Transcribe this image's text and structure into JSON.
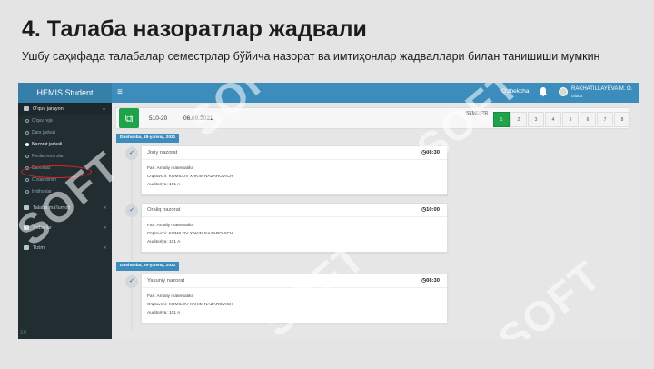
{
  "slide": {
    "title": "4. Талаба назоратлар жадвали",
    "subtitle": "Ушбу саҳифада талабалар семестрлар бўйича назорат ва имтиҳонлар жадваллари билан танишиши мумкин"
  },
  "topbar": {
    "brand": "HEMIS Student",
    "menu_glyph": "≡",
    "language": "O'zbekcha",
    "user_name": "RAKHATILLAYEVA M. O.",
    "user_role": "talaba"
  },
  "sidebar": {
    "section": "O'quv jarayoni",
    "section_chevron": "⌄",
    "sub_items": [
      "O'quv reja",
      "Dars jadvali",
      "Nazorat jadvali",
      "Fanlar resurslari",
      "Davomat",
      "O'zlashtirish",
      "Imtihonlar"
    ],
    "active_index": 2,
    "items": [
      "Talaba ma'lumoti",
      "Xabarlar",
      "Tizim"
    ],
    "item_chevron": "‹",
    "footer": "3.0"
  },
  "filter": {
    "year": "510-20",
    "date": "06.09.2021",
    "semester_label": "SEMESTR",
    "semesters": [
      "1",
      "2",
      "3",
      "4",
      "5",
      "6",
      "7",
      "8"
    ],
    "active_semester": "1",
    "plan_icon_glyph": "⧉"
  },
  "groups": [
    {
      "date_label": "Dushanba, 18-yanvar, 2021",
      "events": [
        {
          "title": "Joriy nazorat",
          "time": "08:30",
          "subject": "Fan: Amaliy matematika",
          "teacher": "O'qituvchi: KOMILOV XAKIM NAZAROVICH",
          "room": "Auditoriya: 101 A"
        },
        {
          "title": "Oraliq nazorat",
          "time": "10:00",
          "subject": "Fan: Amaliy matematika",
          "teacher": "O'qituvchi: KOMILOV XAKIM NAZAROVICH",
          "room": "Auditoriya: 101 A"
        }
      ]
    },
    {
      "date_label": "Dushanba, 25-yanvar, 2021",
      "events": [
        {
          "title": "Yakuniy nazorat",
          "time": "08:30",
          "subject": "Fan: Amaliy matematika",
          "teacher": "O'qituvchi: KOMILOV XAKIM NAZAROVICH",
          "room": "Auditoriya: 101 A"
        }
      ]
    }
  ],
  "icons": {
    "check": "check-icon",
    "clock": "clock-icon",
    "bell": "bell-icon",
    "plan": "plan-icon"
  },
  "watermark_text": "SOFT",
  "colors": {
    "topbar": "#3c8dbc",
    "sidebar": "#222d32",
    "accent": "#1fa34a",
    "highlight": "#d62728"
  }
}
